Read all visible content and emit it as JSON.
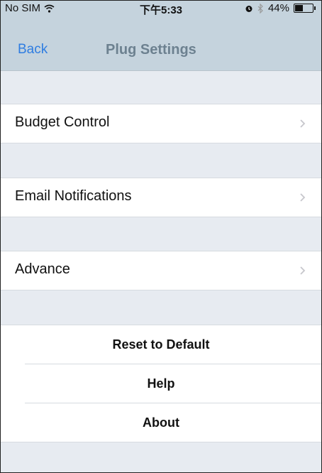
{
  "status_bar": {
    "carrier": "No SIM",
    "time": "下午5:33",
    "battery": "44%",
    "battery_level": 0.44,
    "icons": [
      "wifi-icon",
      "alarm-icon",
      "bluetooth-icon",
      "battery-icon"
    ]
  },
  "nav": {
    "back_label": "Back",
    "title": "Plug Settings"
  },
  "settings": [
    {
      "label": "Budget Control"
    },
    {
      "label": "Email Notifications"
    },
    {
      "label": "Advance"
    }
  ],
  "actions": [
    {
      "label": "Reset to Default"
    },
    {
      "label": "Help"
    },
    {
      "label": "About"
    }
  ],
  "colors": {
    "nav_background": "#c5d3dd",
    "link_blue": "#2f7de1",
    "group_background": "#e7ebf1"
  }
}
